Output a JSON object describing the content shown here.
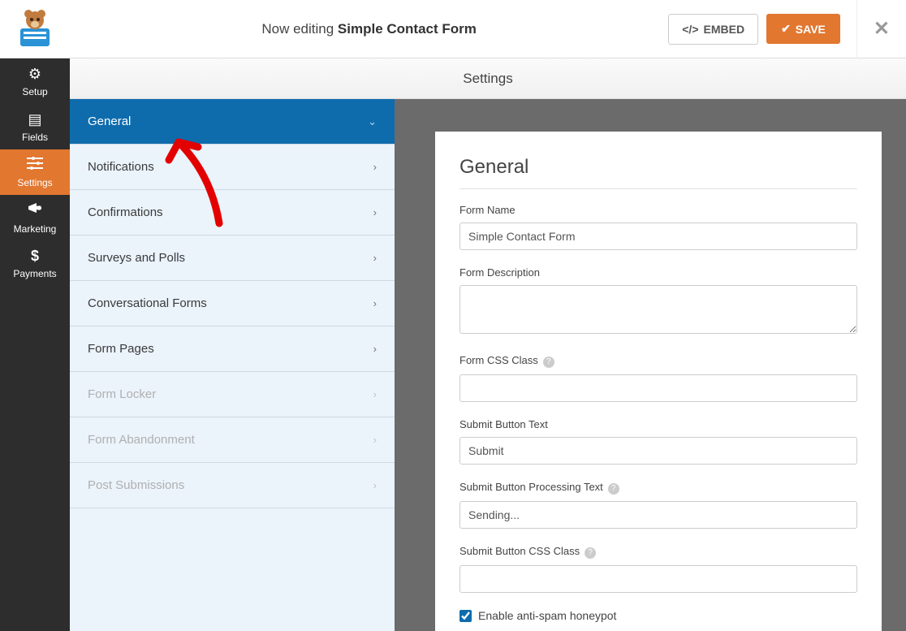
{
  "header": {
    "editing_prefix": "Now editing",
    "form_name": "Simple Contact Form",
    "embed_label": "EMBED",
    "save_label": "SAVE"
  },
  "leftnav": {
    "items": [
      {
        "label": "Setup",
        "icon": "gear"
      },
      {
        "label": "Fields",
        "icon": "list"
      },
      {
        "label": "Settings",
        "icon": "sliders",
        "active": true
      },
      {
        "label": "Marketing",
        "icon": "bullhorn"
      },
      {
        "label": "Payments",
        "icon": "dollar"
      }
    ]
  },
  "page_title": "Settings",
  "subnav": {
    "items": [
      {
        "label": "General",
        "active": true,
        "chevron": "down"
      },
      {
        "label": "Notifications"
      },
      {
        "label": "Confirmations"
      },
      {
        "label": "Surveys and Polls"
      },
      {
        "label": "Conversational Forms"
      },
      {
        "label": "Form Pages"
      },
      {
        "label": "Form Locker",
        "disabled": true
      },
      {
        "label": "Form Abandonment",
        "disabled": true
      },
      {
        "label": "Post Submissions",
        "disabled": true
      }
    ]
  },
  "panel": {
    "heading": "General",
    "fields": {
      "form_name": {
        "label": "Form Name",
        "value": "Simple Contact Form"
      },
      "form_description": {
        "label": "Form Description",
        "value": ""
      },
      "form_css_class": {
        "label": "Form CSS Class",
        "value": ""
      },
      "submit_text": {
        "label": "Submit Button Text",
        "value": "Submit"
      },
      "submit_processing": {
        "label": "Submit Button Processing Text",
        "value": "Sending..."
      },
      "submit_css_class": {
        "label": "Submit Button CSS Class",
        "value": ""
      },
      "honeypot": {
        "label": "Enable anti-spam honeypot",
        "checked": true
      }
    }
  }
}
